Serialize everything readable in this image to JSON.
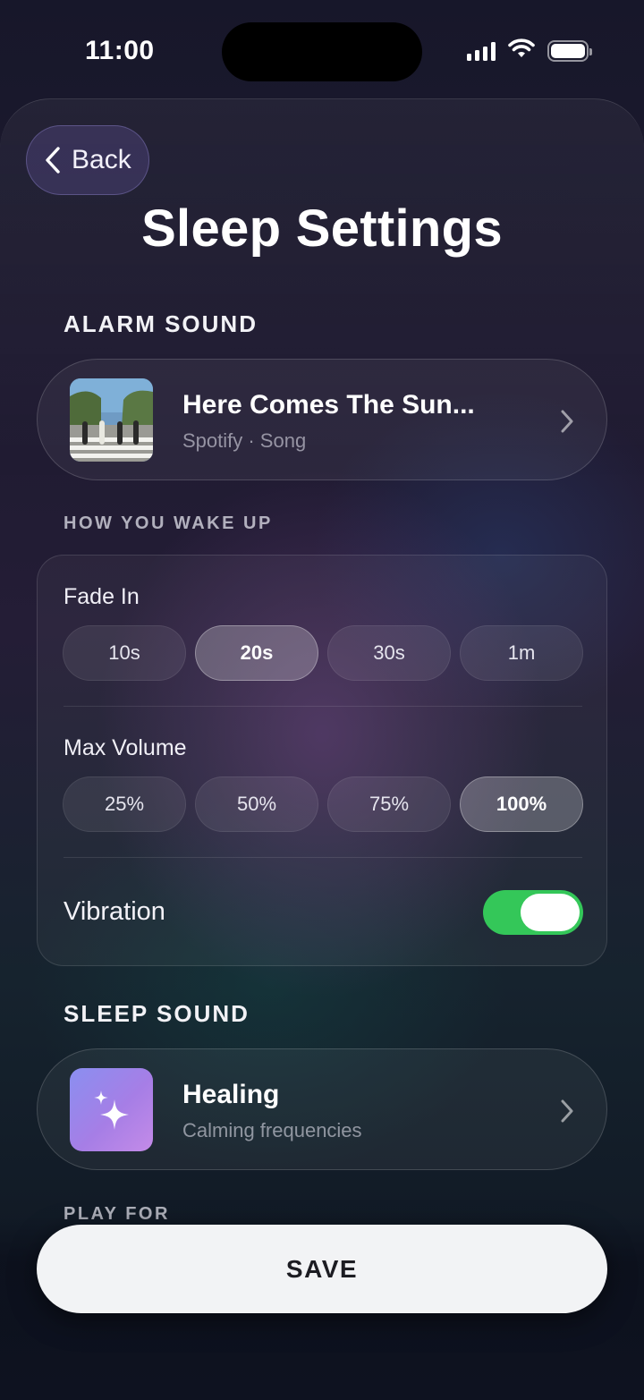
{
  "status_bar": {
    "time": "11:00"
  },
  "nav": {
    "back_label": "Back"
  },
  "page_title": "Sleep Settings",
  "alarm": {
    "heading": "ALARM SOUND",
    "track_title": "Here Comes The Sun...",
    "track_subtitle": "Spotify · Song"
  },
  "wake": {
    "heading": "HOW YOU WAKE UP",
    "fade_in": {
      "label": "Fade In",
      "options": [
        "10s",
        "20s",
        "30s",
        "1m"
      ],
      "selected": "20s"
    },
    "max_volume": {
      "label": "Max Volume",
      "options": [
        "25%",
        "50%",
        "75%",
        "100%"
      ],
      "selected": "100%"
    },
    "vibration": {
      "label": "Vibration",
      "on": true
    }
  },
  "sleep_sound": {
    "heading": "SLEEP SOUND",
    "title": "Healing",
    "subtitle": "Calming frequencies",
    "icon": "sparkles-icon"
  },
  "play_for": {
    "heading": "PLAY FOR"
  },
  "save": {
    "label": "SAVE"
  },
  "colors": {
    "toggle_on": "#34c759",
    "save_bg": "#f2f3f5",
    "healing_gradient_start": "#8a8ff0",
    "healing_gradient_end": "#c48be8"
  }
}
